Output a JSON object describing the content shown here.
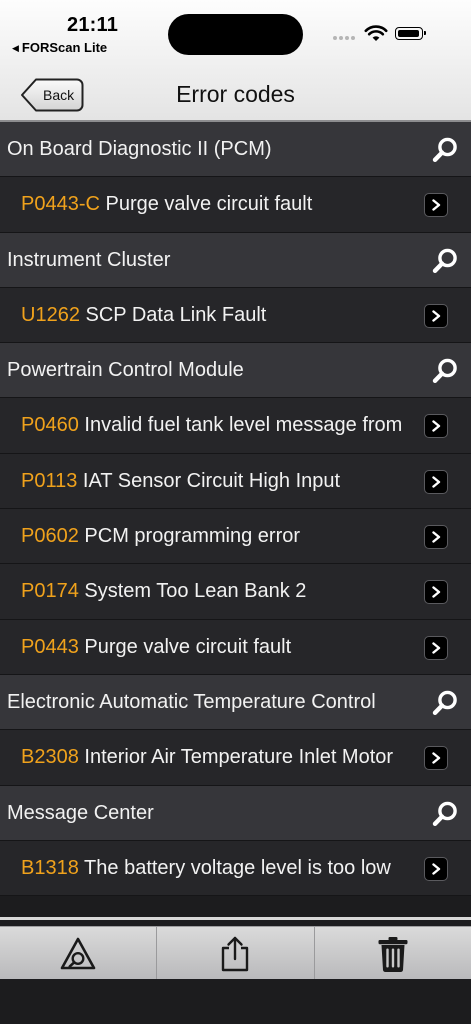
{
  "status_bar": {
    "time": "21:11",
    "back_app": "FORScan Lite"
  },
  "nav": {
    "back_label": "Back",
    "title": "Error codes"
  },
  "colors": {
    "code": "#f0a21c",
    "section_bg": "#36363a",
    "item_bg": "#262629"
  },
  "rows": [
    {
      "type": "section",
      "text": "On Board Diagnostic II (PCM)"
    },
    {
      "type": "item",
      "code": "P0443-C",
      "desc": "Purge valve circuit fault"
    },
    {
      "type": "section",
      "text": "Instrument Cluster"
    },
    {
      "type": "item",
      "code": "U1262",
      "desc": "SCP Data Link Fault"
    },
    {
      "type": "section",
      "text": "Powertrain Control Module"
    },
    {
      "type": "item",
      "code": "P0460",
      "desc": "Invalid fuel tank level message from"
    },
    {
      "type": "item",
      "code": "P0113",
      "desc": "IAT Sensor Circuit High Input"
    },
    {
      "type": "item",
      "code": "P0602",
      "desc": "PCM programming error"
    },
    {
      "type": "item",
      "code": "P0174",
      "desc": "System Too Lean Bank 2"
    },
    {
      "type": "item",
      "code": "P0443",
      "desc": "Purge valve circuit fault"
    },
    {
      "type": "section",
      "text": "Electronic Automatic Temperature Control"
    },
    {
      "type": "item",
      "code": "B2308",
      "desc": "Interior Air Temperature Inlet Motor"
    },
    {
      "type": "section",
      "text": "Message Center"
    },
    {
      "type": "item",
      "code": "B1318",
      "desc": "The battery voltage level is too low"
    }
  ],
  "toolbar": {
    "items": [
      {
        "icon": "scan-icon"
      },
      {
        "icon": "share-icon"
      },
      {
        "icon": "trash-icon"
      }
    ]
  }
}
